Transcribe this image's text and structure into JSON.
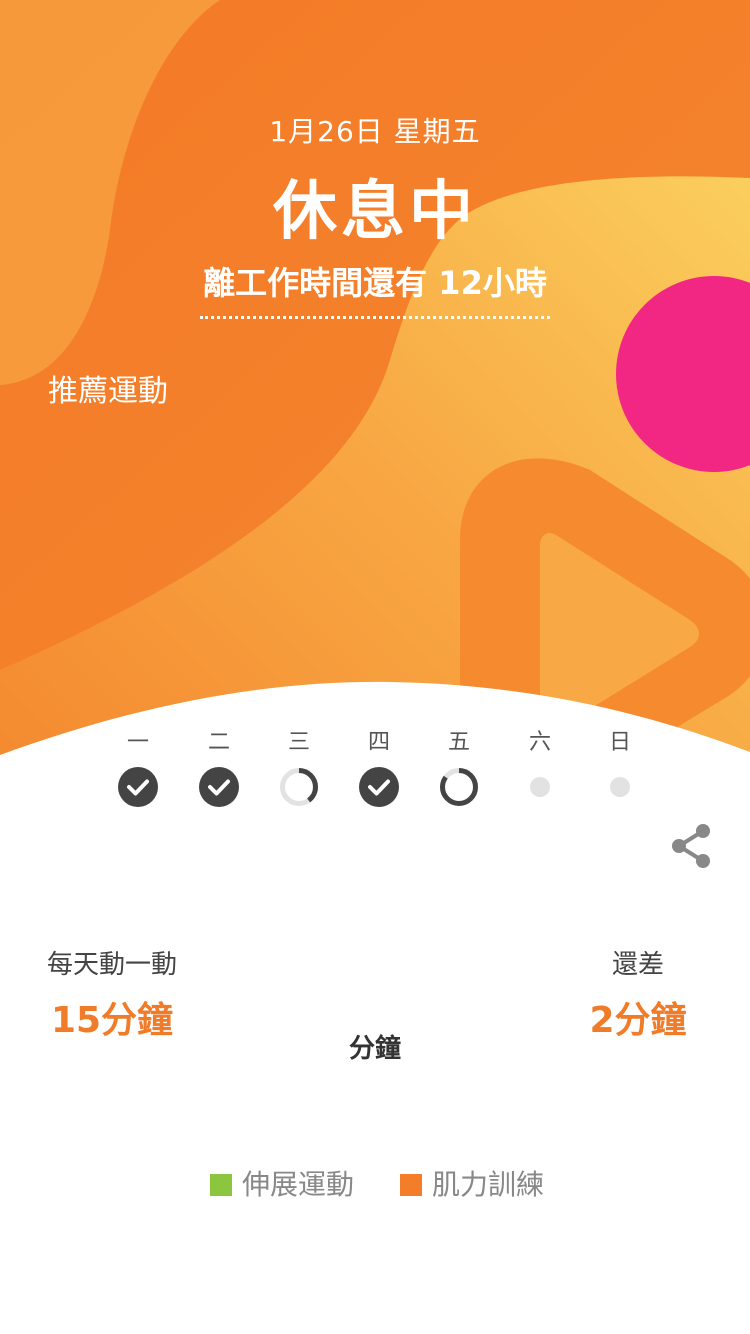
{
  "header": {
    "date": "1月26日 星期五",
    "status": "休息中",
    "countdown": "離工作時間還有 12小時",
    "recommend": "推薦運動"
  },
  "week": {
    "days": [
      {
        "label": "一",
        "state": "done"
      },
      {
        "label": "二",
        "state": "done"
      },
      {
        "label": "三",
        "state": "partial",
        "progress": 0.4
      },
      {
        "label": "四",
        "state": "done"
      },
      {
        "label": "五",
        "state": "partial",
        "progress": 0.85
      },
      {
        "label": "六",
        "state": "none"
      },
      {
        "label": "日",
        "state": "none"
      }
    ]
  },
  "goal": {
    "daily_label": "每天動一動",
    "daily_value": "15分鐘",
    "remaining_label": "還差",
    "remaining_value": "2分鐘",
    "unit": "分鐘"
  },
  "legend": [
    {
      "label": "伸展運動",
      "color": "#8cc63f"
    },
    {
      "label": "肌力訓練",
      "color": "#f47d2a"
    }
  ],
  "colors": {
    "accent": "#f07c2a",
    "dark_check": "#444444",
    "pink_circle": "#f22783",
    "gradient_light": "#fbd561",
    "gradient_dark": "#f47521"
  },
  "icons": {
    "share": "share-icon",
    "check": "check-icon"
  }
}
